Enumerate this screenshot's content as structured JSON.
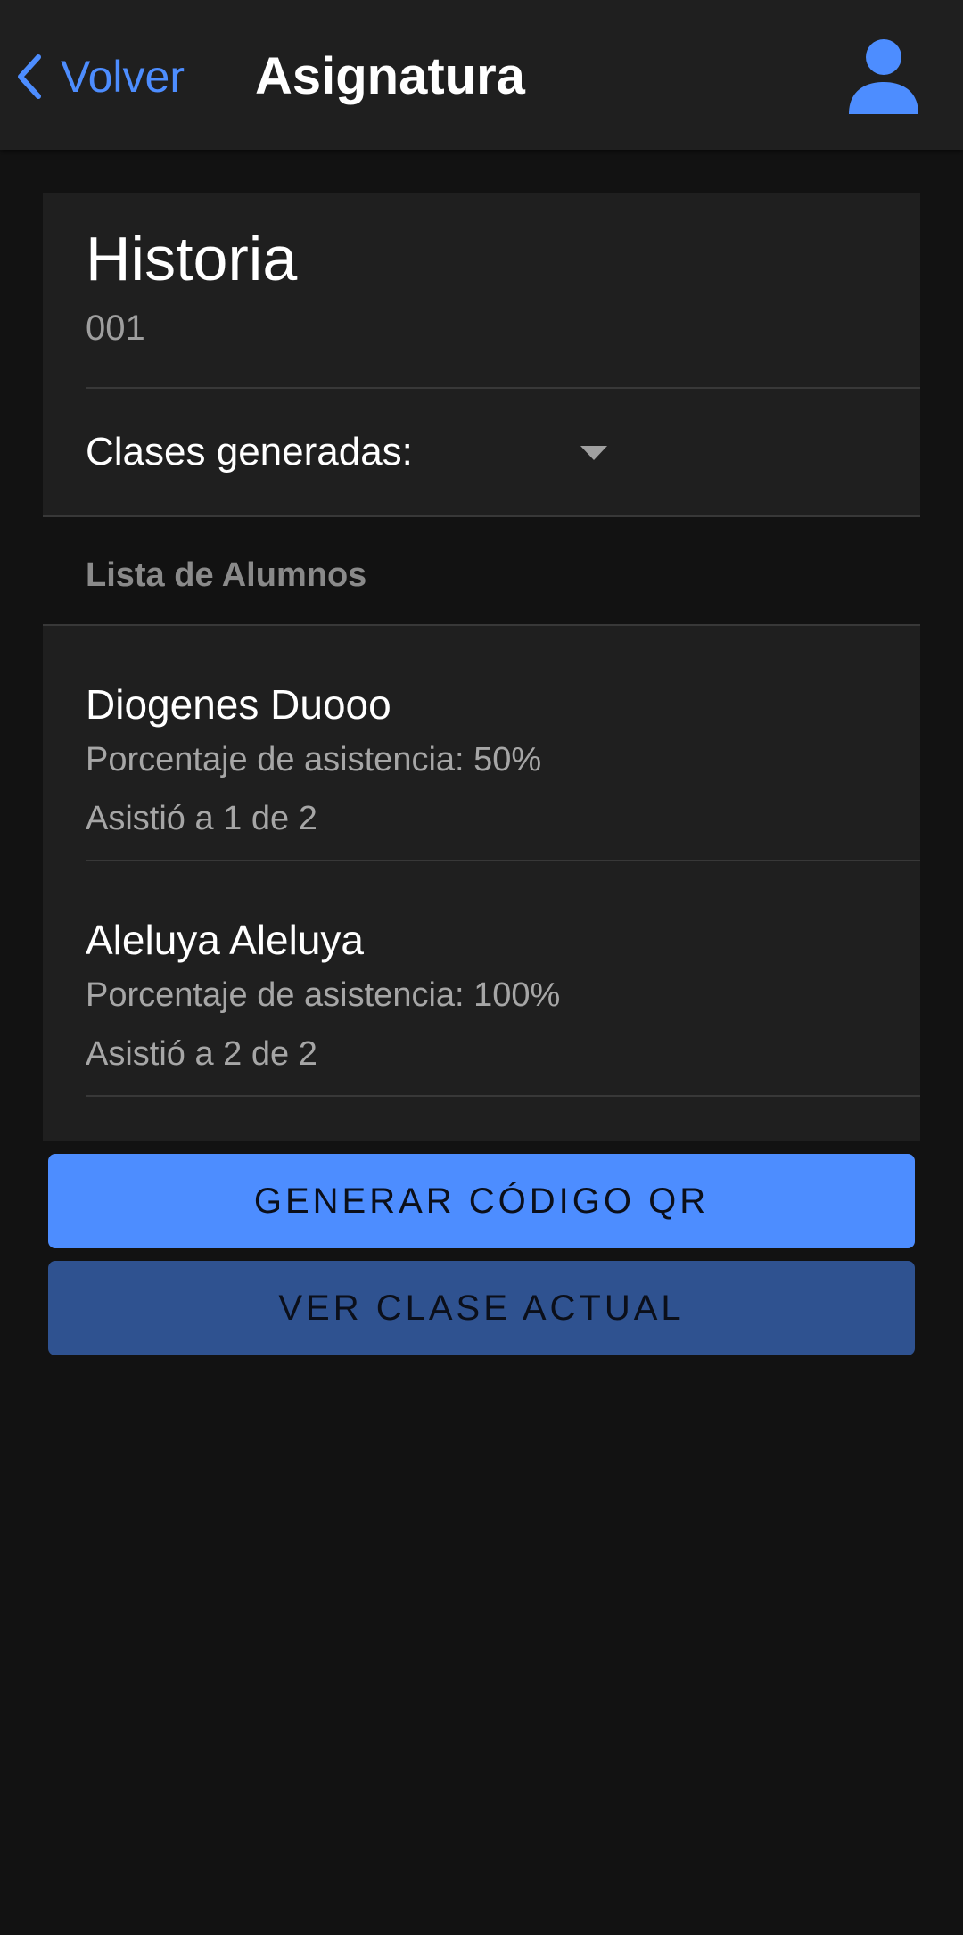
{
  "header": {
    "back_label": "Volver",
    "title": "Asignatura",
    "back_icon": "chevron-left-icon",
    "avatar_icon": "person-icon"
  },
  "subject": {
    "name": "Historia",
    "code": "001",
    "classes_label": "Clases generadas:",
    "classes_selected": ""
  },
  "students": {
    "header": "Lista de Alumnos",
    "items": [
      {
        "name": "Diogenes Duooo",
        "percent": "Porcentaje de asistencia: 50%",
        "attended": "Asistió a 1 de 2"
      },
      {
        "name": "Aleluya Aleluya",
        "percent": "Porcentaje de asistencia: 100%",
        "attended": "Asistió a 2 de 2"
      }
    ]
  },
  "actions": {
    "generate_qr": "GENERAR CÓDIGO QR",
    "view_current": "VER CLASE ACTUAL"
  },
  "colors": {
    "accent": "#4d8dff",
    "accent_dark": "#2f5290",
    "background": "#121212",
    "surface": "#1f1f1f"
  }
}
